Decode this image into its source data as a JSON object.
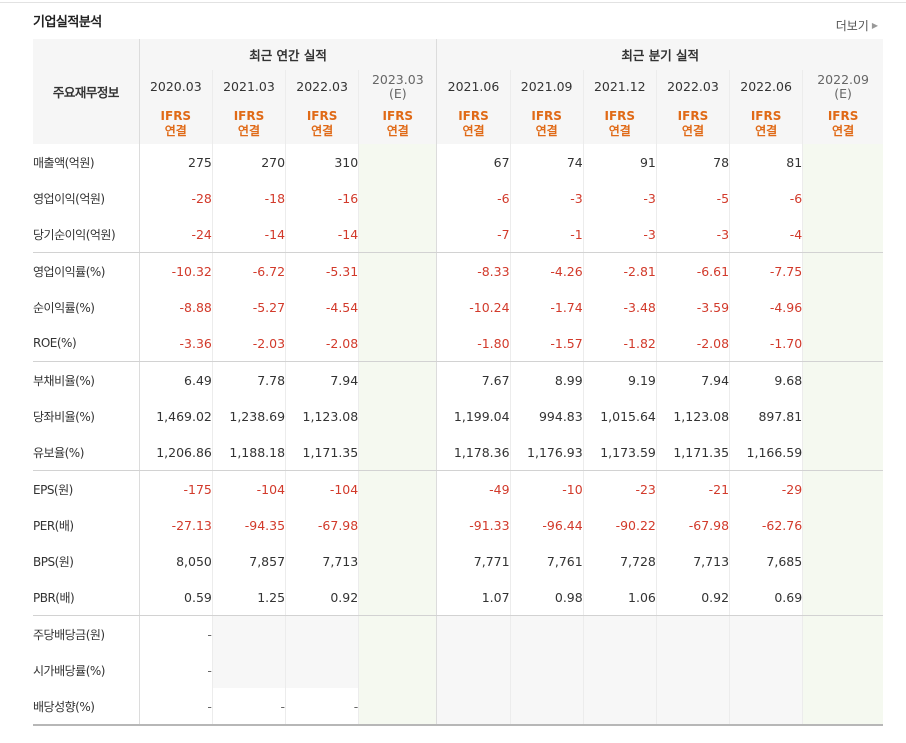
{
  "section": {
    "title": "기업실적분석",
    "more_label": "더보기"
  },
  "header": {
    "corner_label": "주요재무정보",
    "annual_group": "최근 연간 실적",
    "quarter_group": "최근 분기 실적",
    "ifrs_line1": "IFRS",
    "ifrs_line2": "연결",
    "periods": [
      {
        "label": "2020.03",
        "sub": ""
      },
      {
        "label": "2021.03",
        "sub": ""
      },
      {
        "label": "2022.03",
        "sub": ""
      },
      {
        "label": "2023.03",
        "sub": "(E)"
      },
      {
        "label": "2021.06",
        "sub": ""
      },
      {
        "label": "2021.09",
        "sub": ""
      },
      {
        "label": "2021.12",
        "sub": ""
      },
      {
        "label": "2022.03",
        "sub": ""
      },
      {
        "label": "2022.06",
        "sub": ""
      },
      {
        "label": "2022.09",
        "sub": "(E)"
      }
    ]
  },
  "rows": [
    {
      "label": "매출액(억원)",
      "values": [
        "275",
        "270",
        "310",
        "",
        "67",
        "74",
        "91",
        "78",
        "81",
        ""
      ]
    },
    {
      "label": "영업이익(억원)",
      "values": [
        "-28",
        "-18",
        "-16",
        "",
        "-6",
        "-3",
        "-3",
        "-5",
        "-6",
        ""
      ]
    },
    {
      "label": "당기순이익(억원)",
      "values": [
        "-24",
        "-14",
        "-14",
        "",
        "-7",
        "-1",
        "-3",
        "-3",
        "-4",
        ""
      ]
    },
    {
      "label": "영업이익률(%)",
      "values": [
        "-10.32",
        "-6.72",
        "-5.31",
        "",
        "-8.33",
        "-4.26",
        "-2.81",
        "-6.61",
        "-7.75",
        ""
      ]
    },
    {
      "label": "순이익률(%)",
      "values": [
        "-8.88",
        "-5.27",
        "-4.54",
        "",
        "-10.24",
        "-1.74",
        "-3.48",
        "-3.59",
        "-4.96",
        ""
      ]
    },
    {
      "label": "ROE(%)",
      "values": [
        "-3.36",
        "-2.03",
        "-2.08",
        "",
        "-1.80",
        "-1.57",
        "-1.82",
        "-2.08",
        "-1.70",
        ""
      ]
    },
    {
      "label": "부채비율(%)",
      "values": [
        "6.49",
        "7.78",
        "7.94",
        "",
        "7.67",
        "8.99",
        "9.19",
        "7.94",
        "9.68",
        ""
      ]
    },
    {
      "label": "당좌비율(%)",
      "values": [
        "1,469.02",
        "1,238.69",
        "1,123.08",
        "",
        "1,199.04",
        "994.83",
        "1,015.64",
        "1,123.08",
        "897.81",
        ""
      ]
    },
    {
      "label": "유보율(%)",
      "values": [
        "1,206.86",
        "1,188.18",
        "1,171.35",
        "",
        "1,178.36",
        "1,176.93",
        "1,173.59",
        "1,171.35",
        "1,166.59",
        ""
      ]
    },
    {
      "label": "EPS(원)",
      "values": [
        "-175",
        "-104",
        "-104",
        "",
        "-49",
        "-10",
        "-23",
        "-21",
        "-29",
        ""
      ]
    },
    {
      "label": "PER(배)",
      "values": [
        "-27.13",
        "-94.35",
        "-67.98",
        "",
        "-91.33",
        "-96.44",
        "-90.22",
        "-67.98",
        "-62.76",
        ""
      ]
    },
    {
      "label": "BPS(원)",
      "values": [
        "8,050",
        "7,857",
        "7,713",
        "",
        "7,771",
        "7,761",
        "7,728",
        "7,713",
        "7,685",
        ""
      ]
    },
    {
      "label": "PBR(배)",
      "values": [
        "0.59",
        "1.25",
        "0.92",
        "",
        "1.07",
        "0.98",
        "1.06",
        "0.92",
        "0.69",
        ""
      ]
    },
    {
      "label": "주당배당금(원)",
      "values": [
        "-",
        "",
        "",
        "",
        "",
        "",
        "",
        "",
        "",
        ""
      ]
    },
    {
      "label": "시가배당률(%)",
      "values": [
        "-",
        "",
        "",
        "",
        "",
        "",
        "",
        "",
        "",
        ""
      ]
    },
    {
      "label": "배당성향(%)",
      "values": [
        "-",
        "-",
        "-",
        "",
        "",
        "",
        "",
        "",
        "",
        ""
      ]
    }
  ],
  "colors": {
    "negative": "#d23a2b",
    "ifrs": "#e06a17",
    "estimate_bg": "#f5f9f0",
    "empty_bg": "#f7f7f7"
  }
}
